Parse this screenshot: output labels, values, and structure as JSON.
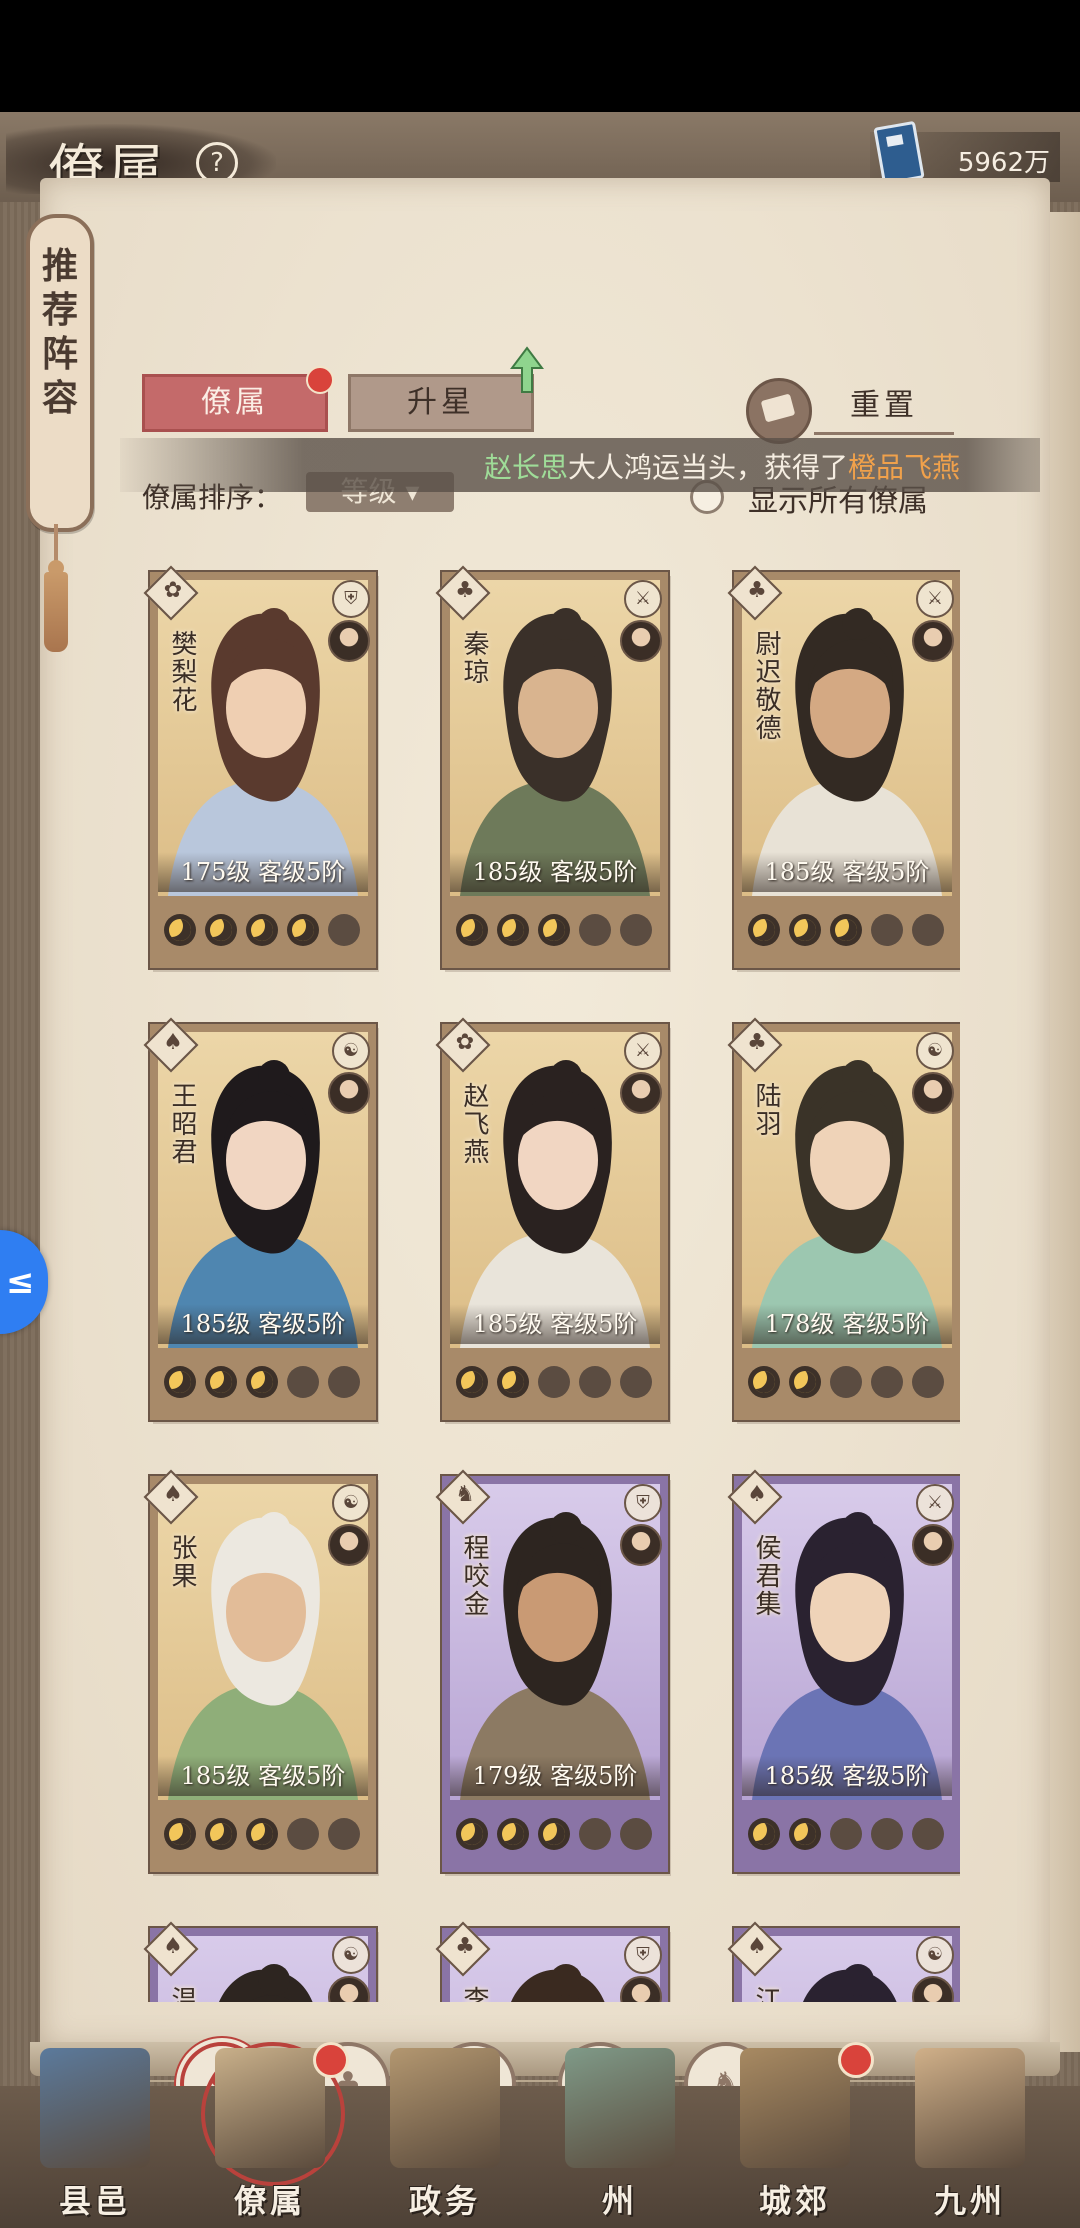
{
  "header": {
    "title": "僚属",
    "currency_value": "5962万"
  },
  "recommend_tag": "推荐阵容",
  "tabs": [
    {
      "label": "僚属",
      "active": true
    },
    {
      "label": "升星",
      "active": false
    }
  ],
  "reset_label": "重置",
  "announcement": {
    "name": "赵长思",
    "middle": "大人鸿运当头，获得了",
    "item": "橙品飞燕"
  },
  "sort": {
    "label": "僚属排序：",
    "value": "等级"
  },
  "show_all_label": "显示所有僚属",
  "cards": [
    {
      "name": "樊梨花",
      "level": "175级",
      "rank": "客级5阶",
      "frame": "gold",
      "stars": 4,
      "type_glyph": "⛨",
      "rarity_glyph": "✿",
      "hair": "#5a3a2e",
      "robe": "#b9c7dc",
      "skin": "#efcfb2"
    },
    {
      "name": "秦琼",
      "level": "185级",
      "rank": "客级5阶",
      "frame": "gold",
      "stars": 3,
      "type_glyph": "⚔",
      "rarity_glyph": "♣",
      "hair": "#3a3029",
      "robe": "#6e7a5a",
      "skin": "#d9b48f"
    },
    {
      "name": "尉迟敬德",
      "level": "185级",
      "rank": "客级5阶",
      "frame": "gold",
      "stars": 3,
      "type_glyph": "⚔",
      "rarity_glyph": "♣",
      "hair": "#332a23",
      "robe": "#e8e2d6",
      "skin": "#d4a983"
    },
    {
      "name": "王昭君",
      "level": "185级",
      "rank": "客级5阶",
      "frame": "gold",
      "stars": 3,
      "type_glyph": "☯",
      "rarity_glyph": "♠",
      "hair": "#1f1a1c",
      "robe": "#4f86b0",
      "skin": "#f1d6c2"
    },
    {
      "name": "赵飞燕",
      "level": "185级",
      "rank": "客级5阶",
      "frame": "gold",
      "stars": 2,
      "type_glyph": "⚔",
      "rarity_glyph": "✿",
      "hair": "#2a2220",
      "robe": "#e9e4da",
      "skin": "#f1d6c2"
    },
    {
      "name": "陆羽",
      "level": "178级",
      "rank": "客级5阶",
      "frame": "gold",
      "stars": 2,
      "type_glyph": "☯",
      "rarity_glyph": "♣",
      "hair": "#3a3328",
      "robe": "#9cc7b0",
      "skin": "#efd3b8"
    },
    {
      "name": "张果",
      "level": "185级",
      "rank": "客级5阶",
      "frame": "gold",
      "stars": 3,
      "type_glyph": "☯",
      "rarity_glyph": "♠",
      "hair": "#ece8e0",
      "robe": "#8fae79",
      "skin": "#e2bc98"
    },
    {
      "name": "程咬金",
      "level": "179级",
      "rank": "客级5阶",
      "frame": "purple",
      "stars": 3,
      "type_glyph": "⛨",
      "rarity_glyph": "♞",
      "hair": "#2d2520",
      "robe": "#8c7a63",
      "skin": "#c99a74"
    },
    {
      "name": "侯君集",
      "level": "185级",
      "rank": "客级5阶",
      "frame": "purple",
      "stars": 2,
      "type_glyph": "⚔",
      "rarity_glyph": "♠",
      "hair": "#2a2230",
      "robe": "#6b74b5",
      "skin": "#efd3b8"
    },
    {
      "name": "温",
      "level": "",
      "rank": "",
      "frame": "purple",
      "stars": 0,
      "type_glyph": "☯",
      "rarity_glyph": "♠",
      "hair": "#2d2520",
      "robe": "#8c7a63",
      "skin": "#efd3b8"
    },
    {
      "name": "李",
      "level": "",
      "rank": "",
      "frame": "purple",
      "stars": 0,
      "type_glyph": "⛨",
      "rarity_glyph": "♣",
      "hair": "#3a2a20",
      "robe": "#8c6a43",
      "skin": "#c99a74"
    },
    {
      "name": "江",
      "level": "",
      "rank": "",
      "frame": "purple",
      "stars": 0,
      "type_glyph": "☯",
      "rarity_glyph": "♠",
      "hair": "#2a2230",
      "robe": "#8b7aa8",
      "skin": "#efd3b8"
    }
  ],
  "filters": [
    {
      "name": "filter-all",
      "glyph": "❖",
      "active": true
    },
    {
      "name": "filter-category-2",
      "glyph": "♣",
      "active": false
    },
    {
      "name": "filter-category-3",
      "glyph": "✿",
      "active": false
    },
    {
      "name": "filter-category-4",
      "glyph": "♠",
      "active": false
    },
    {
      "name": "filter-category-5",
      "glyph": "♞",
      "active": false
    }
  ],
  "bottom_nav": [
    {
      "label": "县邑",
      "badge": false,
      "selected": false,
      "color": "#5b7a9c"
    },
    {
      "label": "僚属",
      "badge": true,
      "selected": true,
      "color": "#c9b08a"
    },
    {
      "label": "政务",
      "badge": false,
      "selected": false,
      "color": "#b39770"
    },
    {
      "label": "州",
      "badge": false,
      "selected": false,
      "color": "#7f9a88"
    },
    {
      "label": "城郊",
      "badge": true,
      "selected": false,
      "color": "#a88a62"
    },
    {
      "label": "九州",
      "badge": false,
      "selected": false,
      "color": "#d0b089"
    }
  ],
  "colors": {
    "accent_red": "#c46a6a",
    "badge_red": "#d9433b",
    "moon_gold": "#f2c65a"
  }
}
